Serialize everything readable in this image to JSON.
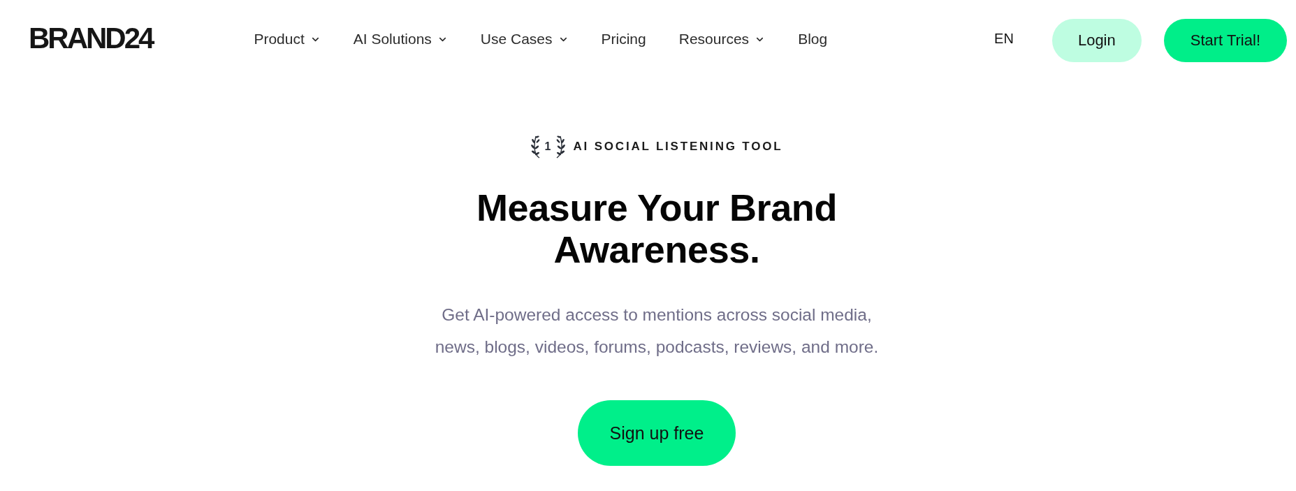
{
  "header": {
    "logo": "BRAND24",
    "nav": [
      {
        "label": "Product",
        "kind": "dropdown"
      },
      {
        "label": "AI Solutions",
        "kind": "dropdown"
      },
      {
        "label": "Use Cases",
        "kind": "dropdown"
      },
      {
        "label": "Pricing",
        "kind": "link"
      },
      {
        "label": "Resources",
        "kind": "dropdown"
      },
      {
        "label": "Blog",
        "kind": "link"
      }
    ],
    "language": "EN",
    "login_button": "Login",
    "trial_button": "Start Trial!"
  },
  "hero": {
    "badge": {
      "rank": "1",
      "text": "AI SOCIAL LISTENING TOOL"
    },
    "heading": "Measure Your Brand Awareness.",
    "description": "Get AI-powered access to mentions across social media, news, blogs, videos, forums, podcasts, reviews, and more.",
    "cta_button": "Sign up free"
  }
}
